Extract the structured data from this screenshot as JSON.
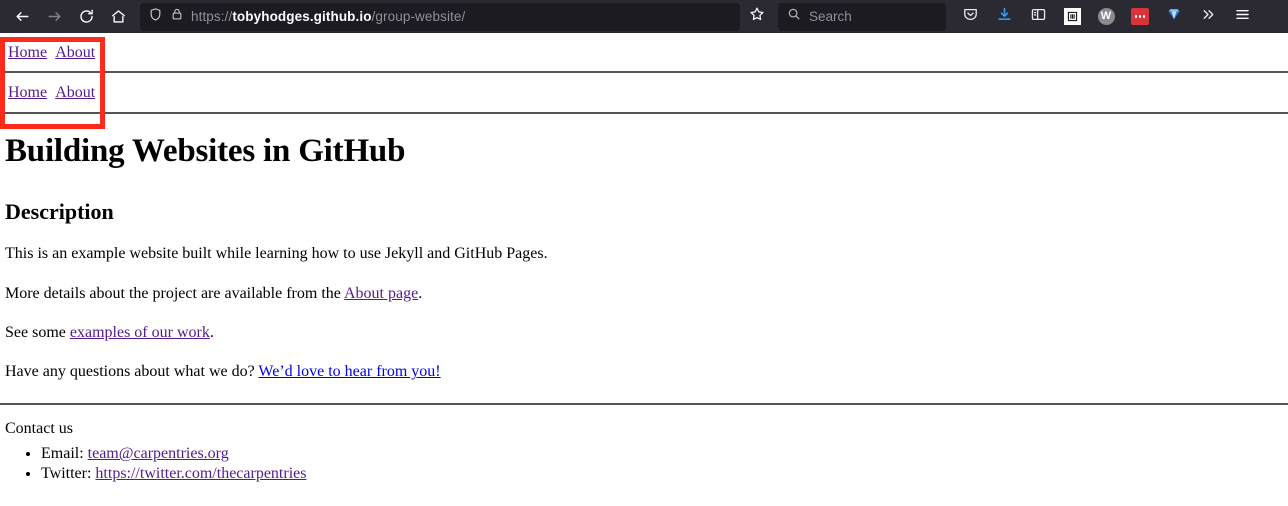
{
  "browser": {
    "nav": {
      "back_icon": "back-arrow-icon",
      "forward_icon": "forward-arrow-icon",
      "reload_icon": "reload-icon",
      "home_icon": "home-icon"
    },
    "urlbar": {
      "shield_icon": "shield-icon",
      "lock_icon": "padlock-icon",
      "scheme": "https://",
      "host": "tobyhodges.github.io",
      "path": "/group-website/",
      "bookmark_icon": "star-icon"
    },
    "search": {
      "icon": "search-icon",
      "placeholder": "Search"
    },
    "extensions": [
      {
        "name": "pocket-icon",
        "label": ""
      },
      {
        "name": "downloads-icon",
        "label": ""
      },
      {
        "name": "sidebar-panel-icon",
        "label": ""
      },
      {
        "name": "library-icon",
        "label": ""
      },
      {
        "name": "wallet-extension-icon",
        "label": "W"
      },
      {
        "name": "red-dots-extension-icon",
        "label": ""
      },
      {
        "name": "blue-gem-extension-icon",
        "label": ""
      },
      {
        "name": "overflow-chevrons-icon",
        "label": ""
      },
      {
        "name": "app-menu-icon",
        "label": ""
      }
    ]
  },
  "site": {
    "nav_primary": {
      "home": "Home",
      "about": "About"
    },
    "nav_secondary": {
      "home": "Home",
      "about": "About"
    },
    "title": "Building Websites in GitHub",
    "description_heading": "Description",
    "paragraphs": {
      "intro": "This is an example website built while learning how to use Jekyll and GitHub Pages.",
      "more_details_prefix": "More details about the project are available from the ",
      "more_details_link": "About page",
      "more_details_suffix": ".",
      "examples_prefix": "See some ",
      "examples_link": "examples of our work",
      "examples_suffix": ".",
      "questions_prefix": "Have any questions about what we do? ",
      "questions_link": "We’d love to hear from you!"
    },
    "footer": {
      "contact_lead": "Contact us",
      "items": [
        {
          "label": "Email: ",
          "link": "team@carpentries.org"
        },
        {
          "label": "Twitter: ",
          "link": "https://twitter.com/thecarpentries"
        }
      ]
    }
  },
  "colors": {
    "annotation": "#fc2b1c",
    "visited_link": "#551a8b",
    "unvisited_link": "#0000ee",
    "chrome_bg": "#2b2a33",
    "urlbar_bg": "#1c1b22"
  }
}
